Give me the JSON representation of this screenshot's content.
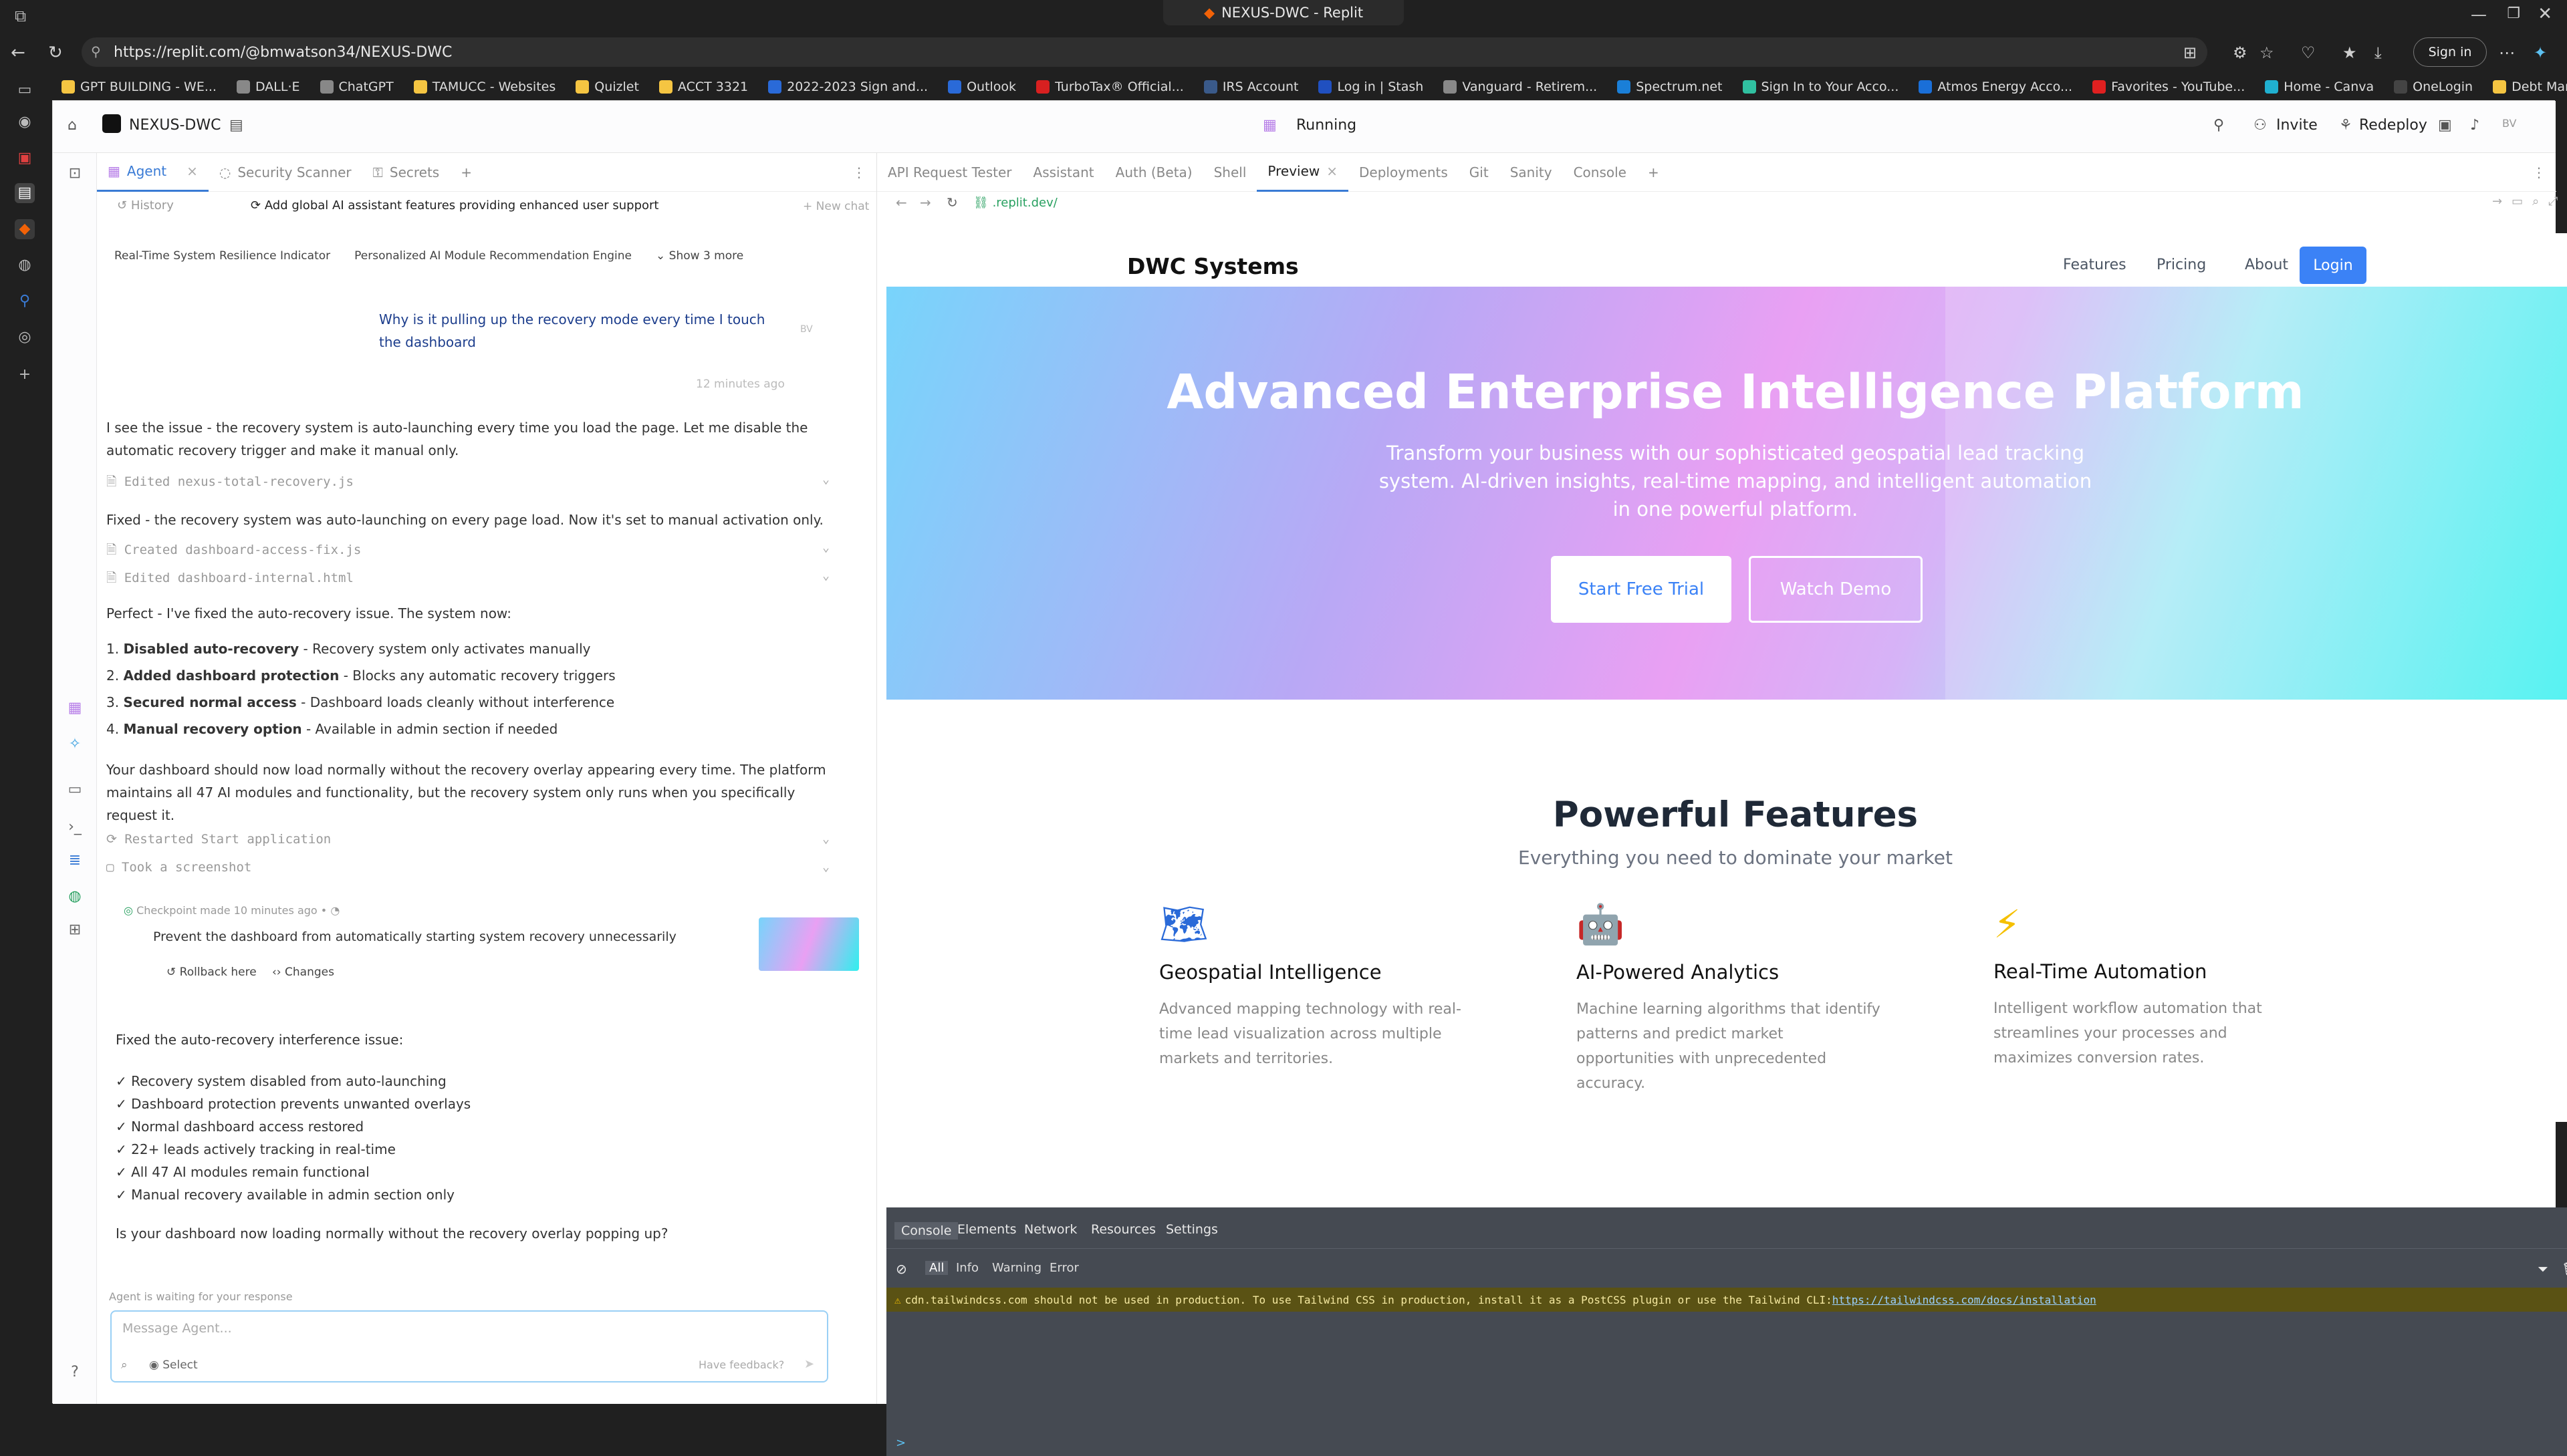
{
  "browser": {
    "tab_title": "NEXUS-DWC - Replit",
    "url": "https://replit.com/@bmwatson34/NEXUS-DWC",
    "sign_in": "Sign in",
    "bookmarks": [
      {
        "label": "GPT BUILDING - WE...",
        "color": "#f5c542"
      },
      {
        "label": "DALL·E",
        "color": "#888888"
      },
      {
        "label": "ChatGPT",
        "color": "#888888"
      },
      {
        "label": "TAMUCC - Websites",
        "color": "#f5c542"
      },
      {
        "label": "Quizlet",
        "color": "#f5c542"
      },
      {
        "label": "ACCT 3321",
        "color": "#f5c542"
      },
      {
        "label": "2022-2023 Sign and...",
        "color": "#2a6ad8"
      },
      {
        "label": "Outlook",
        "color": "#2a6ad8"
      },
      {
        "label": "TurboTax® Official...",
        "color": "#d82020"
      },
      {
        "label": "IRS Account",
        "color": "#3a5a8a"
      },
      {
        "label": "Log in | Stash",
        "color": "#2050c0"
      },
      {
        "label": "Vanguard - Retirem...",
        "color": "#888888"
      },
      {
        "label": "Spectrum.net",
        "color": "#1a7fd8"
      },
      {
        "label": "Sign In to Your Acco...",
        "color": "#30c0a0"
      },
      {
        "label": "Atmos Energy Acco...",
        "color": "#1a6fd8"
      },
      {
        "label": "Favorites - YouTube...",
        "color": "#e02020"
      },
      {
        "label": "Home - Canva",
        "color": "#20b0d0"
      },
      {
        "label": "OneLogin",
        "color": "#444444"
      },
      {
        "label": "Debt Management:...",
        "color": "#f5c542"
      }
    ]
  },
  "replit": {
    "project": "NEXUS-DWC",
    "status": "Running",
    "invite": "Invite",
    "redeploy": "Redeploy",
    "avatar": "BV",
    "left_tabs": [
      "Agent",
      "Security Scanner",
      "Secrets"
    ],
    "right_tabs": [
      "API Request Tester",
      "Assistant",
      "Auth (Beta)",
      "Shell",
      "Preview",
      "Deployments",
      "Git",
      "Sanity",
      "Console"
    ],
    "history": "History",
    "chat_title": "Add global AI assistant features providing enhanced user support",
    "new_chat": "+ New chat",
    "suggestions": [
      "Real-Time System Resilience Indicator",
      "Personalized AI Module Recommendation Engine",
      "Show 3 more"
    ],
    "user_msg": "Why is it pulling up the recovery mode every time I touch the dashboard",
    "user_avatar": "BV",
    "user_time": "12 minutes ago",
    "agent_msg1": "I see the issue - the recovery system is auto-launching every time you load the page. Let me disable the automatic recovery trigger and make it manual only.",
    "edit1": "Edited nexus-total-recovery.js",
    "agent_msg2": "Fixed - the recovery system was auto-launching on every page load. Now it's set to manual activation only.",
    "edit2": "Created dashboard-access-fix.js",
    "edit3": "Edited dashboard-internal.html",
    "agent_msg3": "Perfect - I've fixed the auto-recovery issue. The system now:",
    "list": [
      {
        "bold": "Disabled auto-recovery",
        "rest": " - Recovery system only activates manually"
      },
      {
        "bold": "Added dashboard protection",
        "rest": " - Blocks any automatic recovery triggers"
      },
      {
        "bold": "Secured normal access",
        "rest": " - Dashboard loads cleanly without interference"
      },
      {
        "bold": "Manual recovery option",
        "rest": " - Available in admin section if needed"
      }
    ],
    "agent_msg4": "Your dashboard should now load normally without the recovery overlay appearing every time. The platform maintains all 47 AI modules and functionality, but the recovery system only runs when you specifically request it.",
    "restarted": "Restarted Start application",
    "screenshot": "Took a screenshot",
    "checkpoint": "Checkpoint made 10 minutes ago",
    "checkpoint_desc": "Prevent the dashboard from automatically starting system recovery unnecessarily",
    "rollback": "Rollback here",
    "changes": "Changes",
    "summary_title": "Fixed the auto-recovery interference issue:",
    "summary": [
      "✓ Recovery system disabled from auto-launching",
      "✓ Dashboard protection prevents unwanted overlays",
      "✓ Normal dashboard access restored",
      "✓ 22+ leads actively tracking in real-time",
      "✓ All 47 AI modules remain functional",
      "✓ Manual recovery available in admin section only"
    ],
    "question": "Is your dashboard now loading normally without the recovery overlay popping up?",
    "waiting": "Agent is waiting for your response",
    "input_placeholder": "Message Agent...",
    "select": "Select",
    "feedback": "Have feedback?",
    "preview_url": ".replit.dev/"
  },
  "site": {
    "brand": "DWC Systems",
    "nav": [
      "Features",
      "Pricing",
      "About"
    ],
    "login": "Login",
    "hero_title": "Advanced Enterprise Intelligence Platform",
    "hero_sub": "Transform your business with our sophisticated geospatial lead tracking system. AI-driven insights, real-time mapping, and intelligent automation in one powerful platform.",
    "cta1": "Start Free Trial",
    "cta2": "Watch Demo",
    "features_title": "Powerful Features",
    "features_sub": "Everything you need to dominate your market",
    "features": [
      {
        "title": "Geospatial Intelligence",
        "desc": "Advanced mapping technology with real-time lead visualization across multiple markets and territories.",
        "icon": "map-icon"
      },
      {
        "title": "AI-Powered Analytics",
        "desc": "Machine learning algorithms that identify patterns and predict market opportunities with unprecedented accuracy.",
        "icon": "robot-icon"
      },
      {
        "title": "Real-Time Automation",
        "desc": "Intelligent workflow automation that streamlines your processes and maximizes conversion rates.",
        "icon": "lightning-icon"
      }
    ]
  },
  "devtools": {
    "tabs": [
      "Console",
      "Elements",
      "Network",
      "Resources",
      "Settings"
    ],
    "filters": [
      "All",
      "Info",
      "Warning",
      "Error"
    ],
    "warning": "cdn.tailwindcss.com should not be used in production. To use Tailwind CSS in production, install it as a PostCSS plugin or use the Tailwind CLI: ",
    "warning_link": "https://tailwindcss.com/docs/installation",
    "prompt": ">"
  }
}
